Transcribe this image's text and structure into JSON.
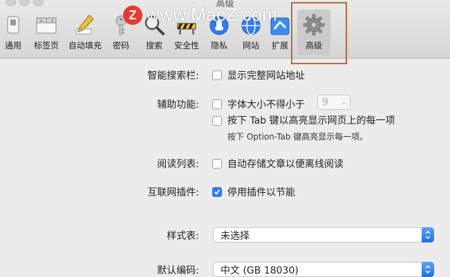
{
  "window": {
    "title": "高级"
  },
  "watermark": {
    "logo": "Z",
    "text": "www.MacZ.com"
  },
  "toolbar": {
    "tabs": [
      {
        "label": "通用",
        "icon": "switch-icon"
      },
      {
        "label": "标签页",
        "icon": "tabs-icon"
      },
      {
        "label": "自动填充",
        "icon": "pencil-icon"
      },
      {
        "label": "密码",
        "icon": "key-icon"
      },
      {
        "label": "搜索",
        "icon": "magnifier-icon"
      },
      {
        "label": "安全性",
        "icon": "caution-icon"
      },
      {
        "label": "隐私",
        "icon": "hand-icon"
      },
      {
        "label": "网站",
        "icon": "globe-icon"
      },
      {
        "label": "扩展",
        "icon": "puzzle-icon"
      },
      {
        "label": "高级",
        "icon": "gear-icon",
        "selected": true
      }
    ]
  },
  "settings": {
    "smart_search": {
      "label": "智能搜索栏:",
      "option": "显示完整网站地址",
      "checked": false
    },
    "accessibility": {
      "label": "辅助功能:",
      "min_font": {
        "text": "字体大小不得小于",
        "checked": false,
        "value": "9"
      },
      "tab_highlight": {
        "text": "按下 Tab 键以高亮显示网页上的每一项",
        "checked": false
      },
      "hint": "按下 Option-Tab 键高亮显示每一项。"
    },
    "reading_list": {
      "label": "阅读列表:",
      "option": "自动存储文章以便离线阅读",
      "checked": false
    },
    "plugins": {
      "label": "互联网插件:",
      "option": "停用插件以节能",
      "checked": true
    },
    "stylesheet": {
      "label": "样式表:",
      "value": "未选择"
    },
    "encoding": {
      "label": "默认编码:",
      "value": "中文 (GB 18030)"
    }
  },
  "colors": {
    "accent": "#2f7cf6",
    "highlight_box": "#b66a3c"
  }
}
